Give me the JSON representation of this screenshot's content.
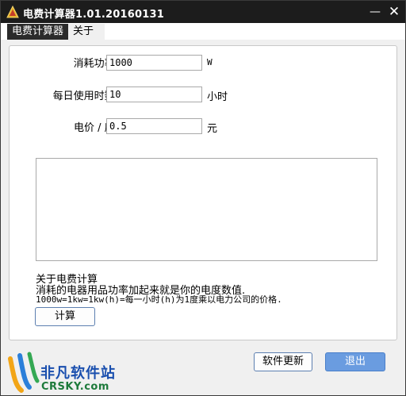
{
  "window": {
    "title": "电费计算器1.01.20160131",
    "minimize_glyph": "—",
    "close_glyph": "✕"
  },
  "menu": {
    "items": [
      {
        "label": "电费计算器"
      },
      {
        "label": "关于"
      }
    ]
  },
  "form": {
    "power": {
      "label": "消耗功率:",
      "value": "1000",
      "unit": "W"
    },
    "hours": {
      "label": "每日使用时数:",
      "value": "10",
      "unit": "小时"
    },
    "price": {
      "label": "电价 / 度:",
      "value": "0.5",
      "unit": "元"
    }
  },
  "result": {
    "text": ""
  },
  "info": {
    "title": "关于电费计算",
    "description": "消耗的电器用品功率加起来就是你的电度数值.",
    "formula": "1000w=1kw=1kw(h)=每一小时(h)为1度乘以电力公司的价格."
  },
  "buttons": {
    "calculate": "计算",
    "update": "软件更新",
    "exit": "退出"
  },
  "watermark": {
    "brand": "非凡软件站",
    "url": "CRSKY.com"
  },
  "icons": {
    "app": "app-triangle-icon",
    "watermark_logo": "crsky-logo-icon"
  },
  "colors": {
    "titlebar": "#1c1c1c",
    "menu_active": "#2b2b2b",
    "button_primary": "#6a9ce0",
    "button_border": "#5c7fb0",
    "watermark_brand": "#1a4fae",
    "watermark_url": "#1d7a3a"
  }
}
